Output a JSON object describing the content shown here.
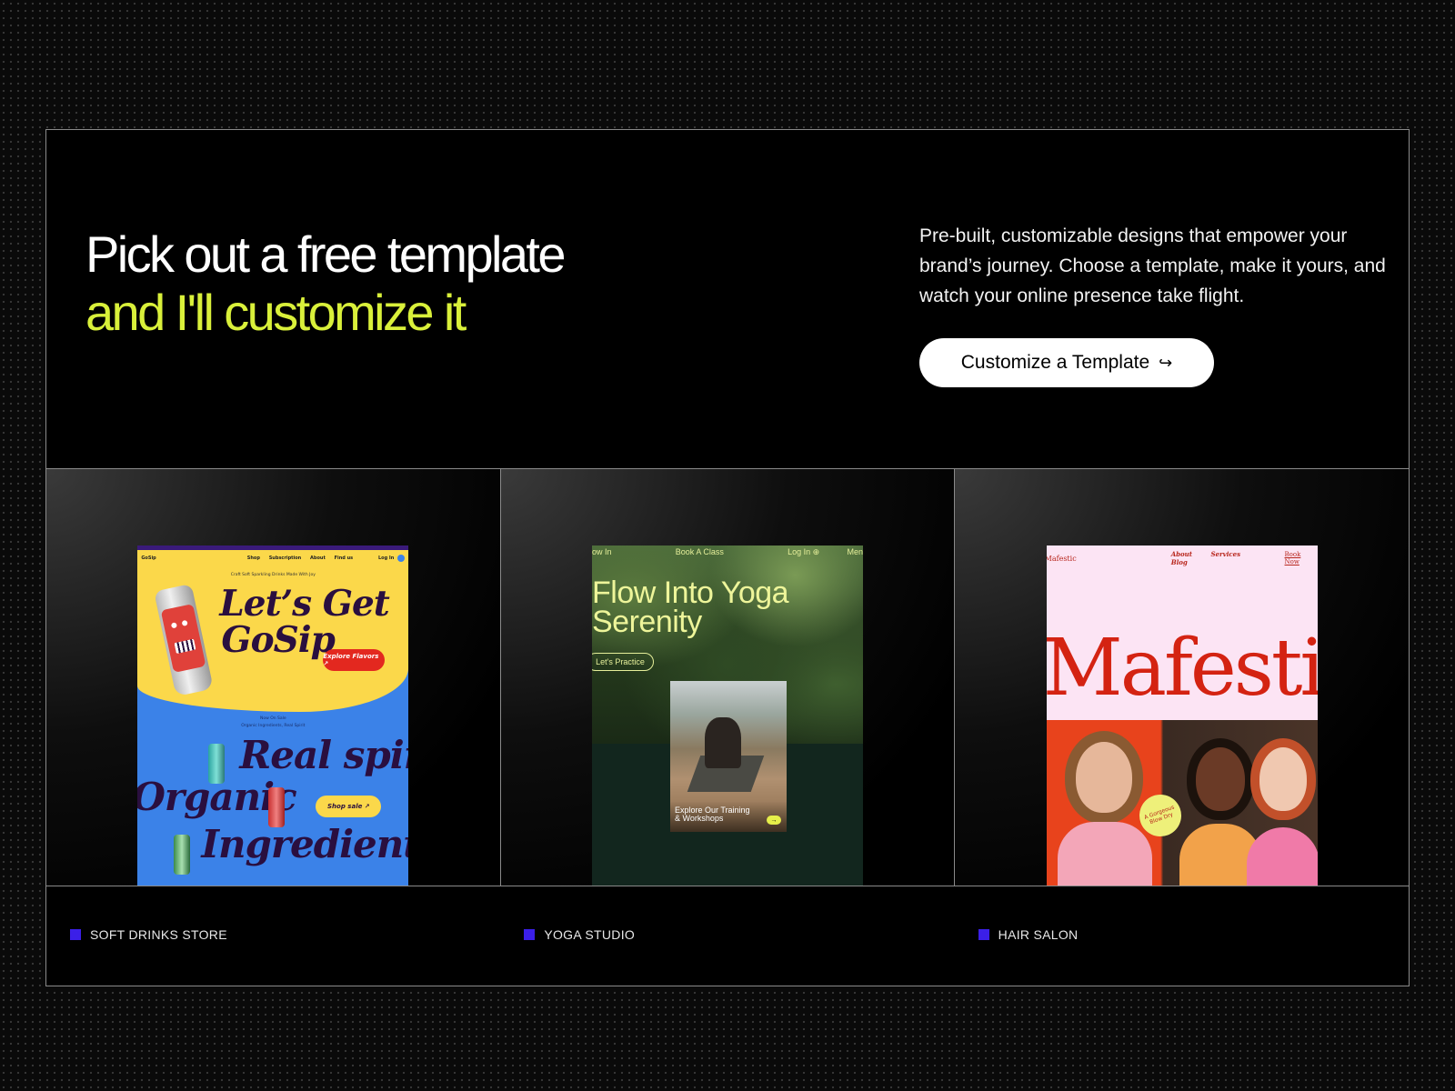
{
  "hero": {
    "headline_line1": "Pick out a free template",
    "headline_line2": "and I'll customize it",
    "description": "Pre-built, customizable designs that empower your brand’s journey.  Choose a template, make it yours, and watch your online presence take flight.",
    "cta_label": "Customize a Template",
    "cta_icon": "↪"
  },
  "colors": {
    "accent": "#d9f03a",
    "label_square": "#3b1fe8",
    "border": "#8a8a8a"
  },
  "templates": [
    {
      "label": "SOFT DRINKS STORE",
      "preview": {
        "logo": "GoSip",
        "nav": [
          "Shop",
          "Subscription",
          "About",
          "Find us"
        ],
        "login": "Log In",
        "tagline": "Craft Soft Sparkling Drinks Made With Joy",
        "headline_1": "Let’s Get",
        "headline_2": "GoSip",
        "button_1": "Explore Flavors ↗",
        "now_on_sale": "Now On Sale",
        "sub_tagline": "Organic Ingredients, Real Spirit",
        "line_a": "Real spirit",
        "line_b": "Organic",
        "line_c": "Ingredients",
        "button_2": "Shop sale ↗"
      }
    },
    {
      "label": "YOGA STUDIO",
      "preview": {
        "nav_left": "ow In",
        "nav_mid": "Book A Class",
        "nav_right": "Log In ⊕",
        "nav_far": "Men",
        "title_1": "Flow Into Yoga",
        "title_2": "Serenity",
        "button": "Let's Practice",
        "caption": "Explore Our Training & Workshops",
        "go": "→"
      }
    },
    {
      "label": "HAIR SALON",
      "preview": {
        "logo": "Mafestic",
        "nav": [
          "About",
          "Services",
          "Blog"
        ],
        "book": "Book Now",
        "wordmark": "Mafestic",
        "badge": "A Gorgeous Blow Dry"
      }
    }
  ]
}
